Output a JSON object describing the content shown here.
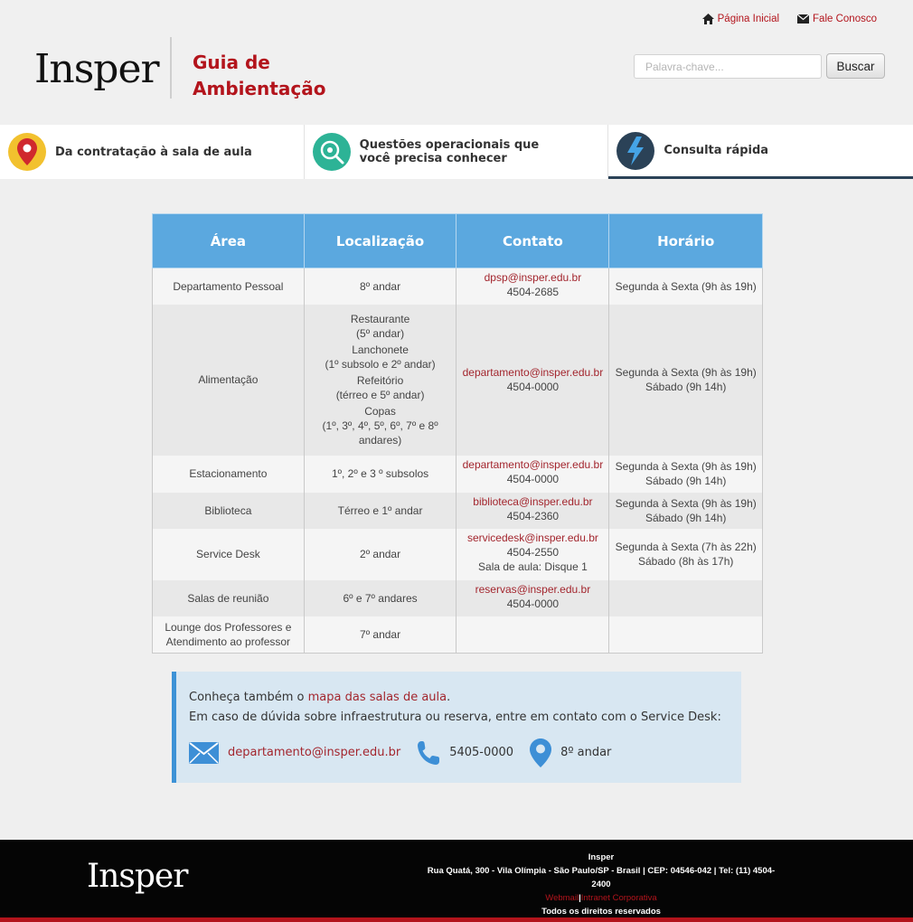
{
  "header": {
    "home_link": "Página Inicial",
    "contact_link": "Fale Conosco",
    "logo": "Insper",
    "title_line1": "Guia de",
    "title_line2": "Ambientação",
    "search_placeholder": "Palavra-chave...",
    "search_button": "Buscar"
  },
  "nav": {
    "items": [
      {
        "label": "Da contratação à sala de aula",
        "icon": "map-pin-icon",
        "color": "#f2c12e"
      },
      {
        "label": "Questões operacionais que você precisa conhecer",
        "icon": "gear-search-icon",
        "color": "#2db396"
      },
      {
        "label": "Consulta rápida",
        "icon": "lightning-icon",
        "color": "#2b4257"
      }
    ]
  },
  "table": {
    "headers": [
      "Área",
      "Localização",
      "Contato",
      "Horário"
    ],
    "rows": [
      {
        "area": [
          "Departamento Pessoal"
        ],
        "local": [
          "8º andar"
        ],
        "email": "dpsp@insper.edu.br",
        "phone": [
          "4504-2685"
        ],
        "hours": [
          "Segunda à Sexta (9h às 19h)"
        ]
      },
      {
        "area": [
          "Alimentação"
        ],
        "local": [
          "Restaurante",
          "(5º andar)",
          "Lanchonete",
          "(1º subsolo e 2º andar)",
          "Refeitório",
          "(térreo e 5º andar)",
          "Copas",
          "(1º, 3º, 4º, 5º, 6º, 7º e 8º andares)"
        ],
        "email": "departamento@insper.edu.br",
        "phone": [
          "4504-0000"
        ],
        "hours": [
          "Segunda à Sexta (9h às 19h)",
          "Sábado (9h 14h)"
        ]
      },
      {
        "area": [
          "Estacionamento"
        ],
        "local": [
          "1º, 2º e 3 º subsolos"
        ],
        "email": "departamento@insper.edu.br",
        "phone": [
          "4504-0000"
        ],
        "hours": [
          "Segunda à Sexta (9h às 19h)",
          "Sábado (9h 14h)"
        ]
      },
      {
        "area": [
          "Biblioteca"
        ],
        "local": [
          "Térreo e 1º andar"
        ],
        "email": "biblioteca@insper.edu.br",
        "phone": [
          "4504-2360"
        ],
        "hours": [
          "Segunda à Sexta (9h às 19h)",
          "Sábado (9h 14h)"
        ]
      },
      {
        "area": [
          "Service Desk"
        ],
        "local": [
          "2º andar"
        ],
        "email": "servicedesk@insper.edu.br",
        "phone": [
          "4504-2550",
          "Sala de aula: Disque 1"
        ],
        "hours": [
          "Segunda à Sexta (7h às 22h)",
          "Sábado (8h às 17h)"
        ]
      },
      {
        "area": [
          "Salas de reunião"
        ],
        "local": [
          "6º e 7º andares"
        ],
        "email": "reservas@insper.edu.br",
        "phone": [
          "4504-0000"
        ],
        "hours": []
      },
      {
        "area": [
          "Lounge dos Professores e",
          "Atendimento ao professor"
        ],
        "local": [
          "7º andar"
        ],
        "email": "",
        "phone": [],
        "hours": []
      }
    ]
  },
  "info": {
    "line1_prefix": "Conheça também o ",
    "line1_link": "mapa das salas de aula",
    "line1_suffix": ".",
    "line2": "Em caso de dúvida sobre infraestrutura ou reserva, entre em contato com o Service Desk:",
    "email": "departamento@insper.edu.br",
    "phone": "5405-0000",
    "location": "8º andar",
    "accent_color": "#3d92d6"
  },
  "footer": {
    "logo": "Insper",
    "name": "Insper",
    "address": "Rua Quatá, 300 - Vila Olímpia - São Paulo/SP - Brasil | CEP: 04546-042 | Tel: (11) 4504-2400",
    "link1": "Webmail",
    "link2": "Intranet Corporativa",
    "rights": "Todos os direitos reservados"
  },
  "colors": {
    "brand_red": "#b3141c",
    "table_header": "#5ba8df",
    "link_red": "#a3262e"
  }
}
